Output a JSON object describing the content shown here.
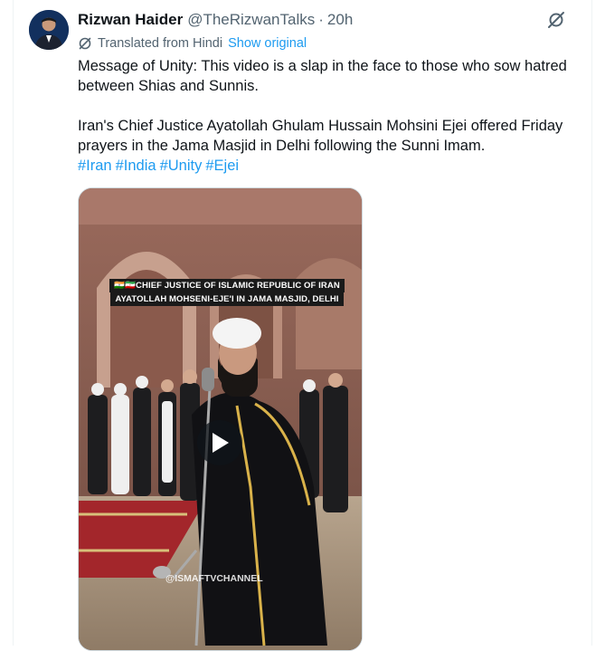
{
  "tweet": {
    "author": {
      "display_name": "Rizwan Haider",
      "handle": "@TheRizwanTalks",
      "separator": "·",
      "time": "20h"
    },
    "translation": {
      "label": "Translated from Hindi",
      "show_original": "Show original"
    },
    "text": {
      "line1": "Message of Unity: This video is a slap in the face to those who sow hatred between Shias and Sunnis.",
      "line2": "Iran's Chief Justice Ayatollah Ghulam Hussain Mohsini Ejei offered Friday prayers in the Jama Masjid in Delhi following the Sunni Imam.",
      "hashtags": [
        "#Iran",
        "#India",
        "#Unity",
        "#Ejei"
      ]
    },
    "media": {
      "caption_line1": "🇮🇳🇮🇷CHIEF JUSTICE OF ISLAMIC REPUBLIC OF IRAN",
      "caption_line2": "AYATOLLAH MOHSENI-EJE'I IN JAMA MASJID, DELHI",
      "watermark": "@ISMAFTVCHANNEL"
    }
  },
  "icons": {
    "grok": "grok-icon",
    "translate": "translate-icon",
    "play": "play-icon"
  },
  "colors": {
    "link": "#1d9bf0",
    "text": "#0f1419",
    "secondary": "#536471",
    "border": "#eff3f4"
  }
}
